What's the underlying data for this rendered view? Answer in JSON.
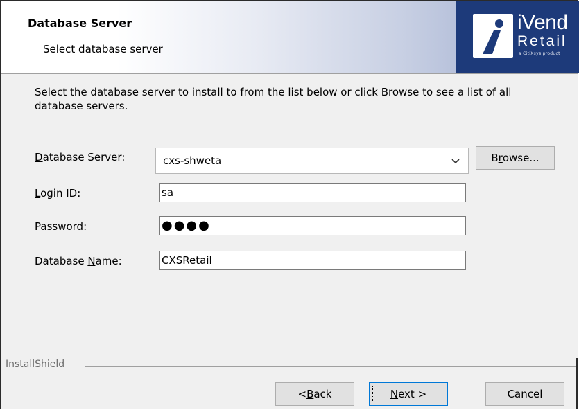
{
  "header": {
    "title": "Database Server",
    "subtitle": "Select database server"
  },
  "logo": {
    "icon": "ivend-i-logo-icon",
    "line1": "iVend",
    "line2": "Retail",
    "tagline": "a CitiXsys product"
  },
  "description": "Select the database server to install to from the list below or click Browse to see a list of all database servers.",
  "form": {
    "server_label_mnemonic": "D",
    "server_label_rest": "atabase Server:",
    "server_value": "cxs-shweta",
    "browse_pre": "B",
    "browse_mnemonic": "r",
    "browse_post": "owse...",
    "login_label_mnemonic": "L",
    "login_label_rest": "ogin ID:",
    "login_value": "sa",
    "password_label_mnemonic": "P",
    "password_label_rest": "assword:",
    "password_value": "●●●●",
    "dbname_label_pre": "Database ",
    "dbname_label_mnemonic": "N",
    "dbname_label_rest": "ame:",
    "dbname_value": "CXSRetail"
  },
  "footer": {
    "brand": "InstallShield",
    "back_pre": "< ",
    "back_mnemonic": "B",
    "back_post": "ack",
    "next_mnemonic": "N",
    "next_post": "ext >",
    "cancel": "Cancel"
  },
  "colors": {
    "logo_bg": "#1d3a7a",
    "button_bg": "#e1e1e1",
    "focus_border": "#0078d7"
  }
}
